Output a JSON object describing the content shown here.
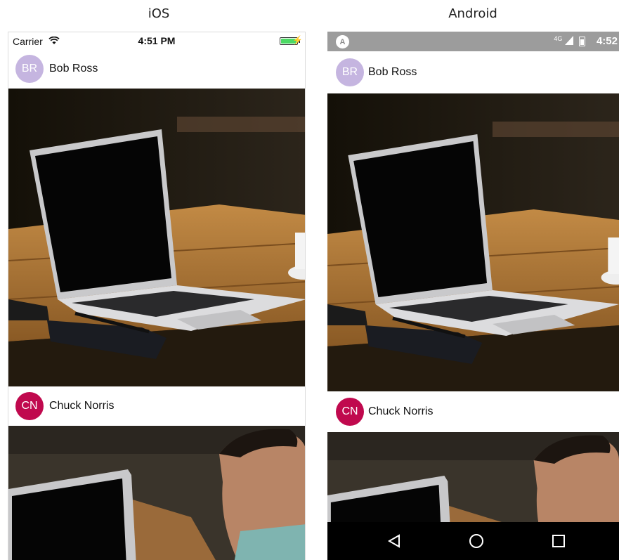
{
  "labels": {
    "ios": "iOS",
    "android": "Android"
  },
  "ios": {
    "status": {
      "carrier": "Carrier",
      "time": "4:51 PM",
      "battery_level": 1.0
    }
  },
  "android": {
    "status": {
      "notif_icon": "A",
      "network": "4G",
      "time": "4:52"
    }
  },
  "posts": [
    {
      "initials": "BR",
      "name": "Bob Ross",
      "avatar_color": "#c5b5e0"
    },
    {
      "initials": "CN",
      "name": "Chuck Norris",
      "avatar_color": "#c0094e"
    }
  ],
  "colors": {
    "wood": "#b07a3a",
    "laptop": "#d9d9db",
    "dark_bg": "#1f1b14",
    "android_nav": "#000000",
    "android_status": "#9c9c9c",
    "ios_battery": "#4cd964"
  }
}
